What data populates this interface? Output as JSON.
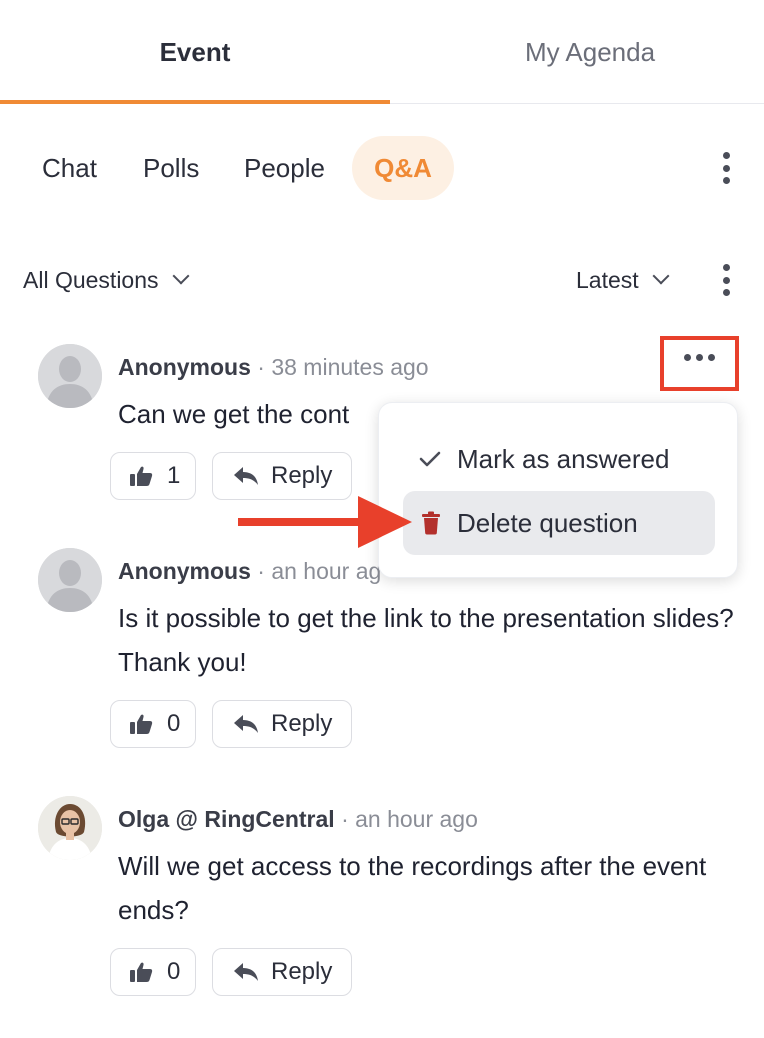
{
  "top_tabs": {
    "event": "Event",
    "agenda": "My Agenda"
  },
  "sub_tabs": {
    "chat": "Chat",
    "polls": "Polls",
    "people": "People",
    "qa": "Q&A"
  },
  "filters": {
    "left": "All Questions",
    "right": "Latest"
  },
  "questions": [
    {
      "author": "Anonymous",
      "time": "· 38 minutes ago",
      "text": "Can we get the cont",
      "likes": "1",
      "reply": "Reply"
    },
    {
      "author": "Anonymous",
      "time": "· an hour ag",
      "text": "Is it possible to get the link to the presentation slides? Thank you!",
      "likes": "0",
      "reply": "Reply"
    },
    {
      "author": "Olga @ RingCentral",
      "time": "· an hour ago",
      "text": "Will we get access to the recordings after the event ends?",
      "likes": "0",
      "reply": "Reply"
    }
  ],
  "menu": {
    "mark": "Mark as answered",
    "delete": "Delete question"
  },
  "colors": {
    "accent": "#f08a35",
    "highlight": "#e8402b",
    "delete_icon": "#b3302c"
  }
}
